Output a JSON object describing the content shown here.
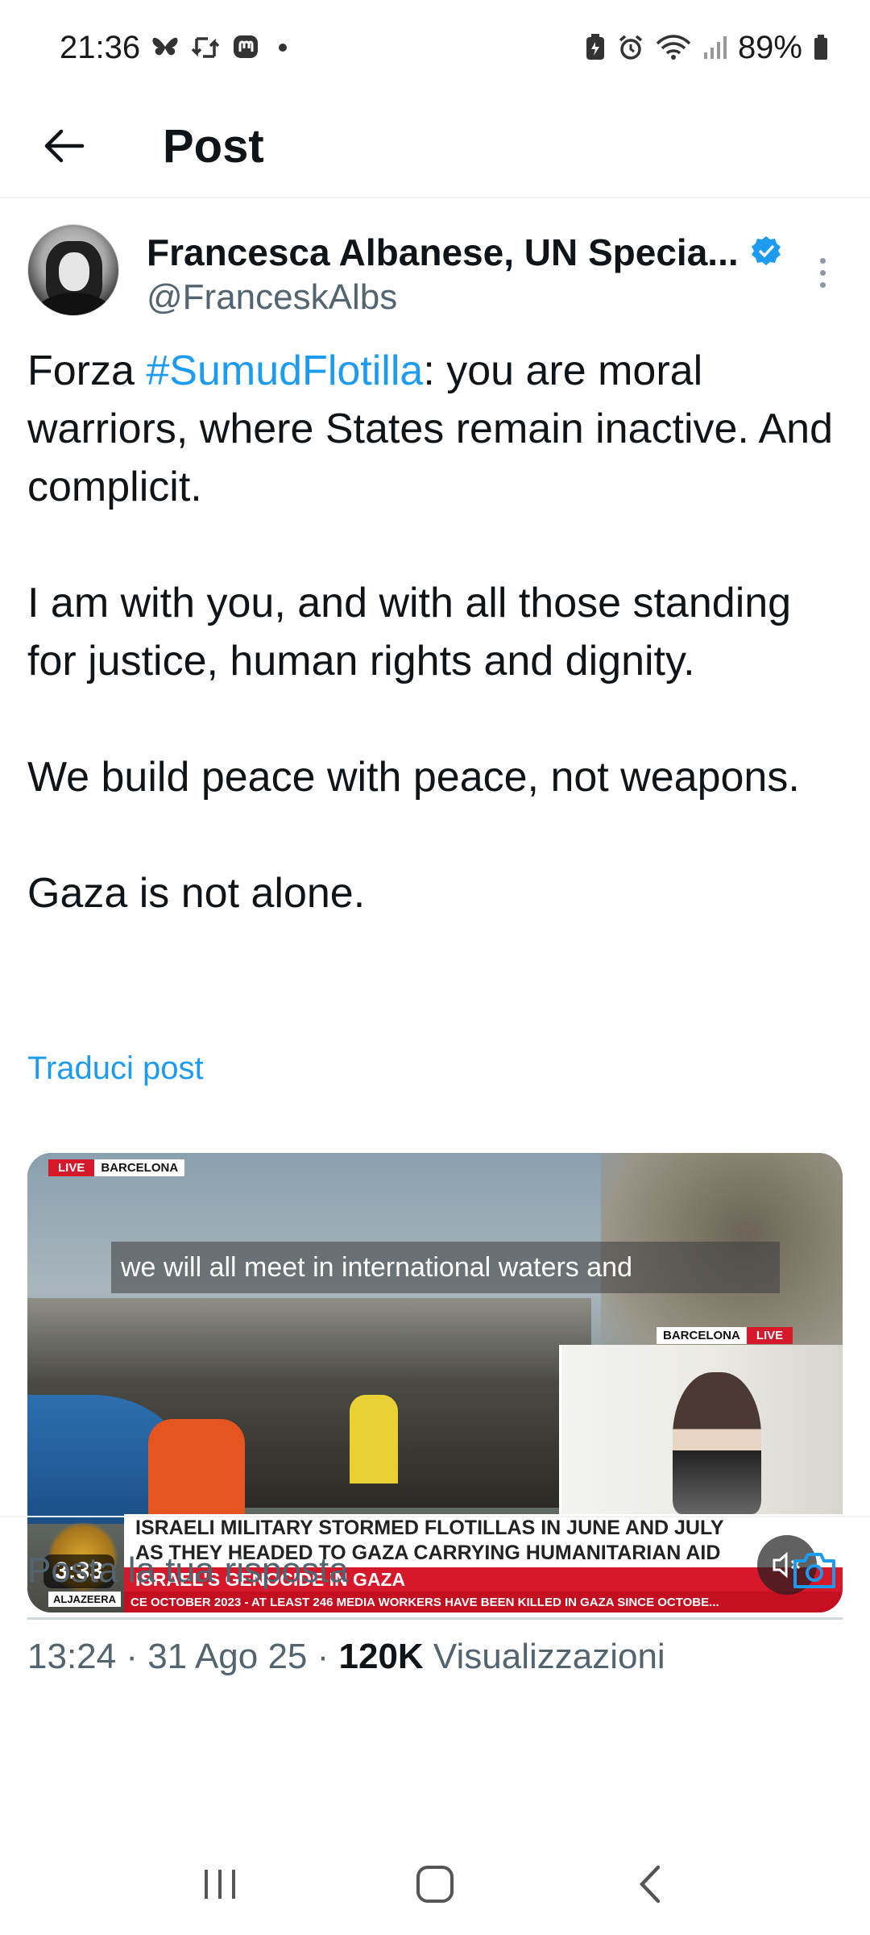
{
  "status_bar": {
    "time": "21:36",
    "battery": "89%",
    "left_icons": [
      "bluesky-icon",
      "retweet-icon",
      "mastodon-icon",
      "dot-icon"
    ],
    "right_icons": [
      "battery-saver-icon",
      "alarm-icon",
      "wifi-icon",
      "signal-icon",
      "battery-icon"
    ]
  },
  "header": {
    "title": "Post"
  },
  "post": {
    "author_name": "Francesca Albanese, UN Specia...",
    "author_handle": "@FranceskAlbs",
    "text": {
      "p1_prefix": "Forza ",
      "p1_hashtag": "#SumudFlotilla",
      "p1_suffix": ": you are moral warriors, where States remain inactive. And complicit.",
      "p2": "I am with you, and with all those standing for justice, human rights and dignity.",
      "p3": "We build peace with peace, not weapons.",
      "p4": "Gaza is not alone."
    },
    "translate_label": "Traduci post",
    "media": {
      "live_label": "LIVE",
      "location_label": "BARCELONA",
      "inset_location_label": "BARCELONA",
      "inset_live_label": "LIVE",
      "caption": "we will all meet in international waters and",
      "headline_line1": "ISRAELI MILITARY STORMED FLOTILLAS IN JUNE AND JULY",
      "headline_line2": "AS THEY HEADED TO GAZA CARRYING HUMANITARIAN AID",
      "banner": "ISRAEL'S GENOCIDE IN GAZA",
      "ticker": "CE OCTOBER 2023  -  AT LEAST 246 MEDIA WORKERS HAVE BEEN KILLED IN GAZA SINCE OCTOBE...",
      "channel_label": "ALJAZEERA",
      "duration": "3:33"
    },
    "meta": {
      "time_date": "13:24 · 31 Ago 25 · ",
      "views_count": "120K",
      "views_label": " Visualizzazioni"
    }
  },
  "reply": {
    "placeholder": "Posta la tua risposta"
  },
  "colors": {
    "accent": "#1d9bf0",
    "secondary_text": "#536471",
    "primary_text": "#0f1419",
    "verified_badge": "#1d9bf0",
    "live_red": "#d6182b"
  }
}
